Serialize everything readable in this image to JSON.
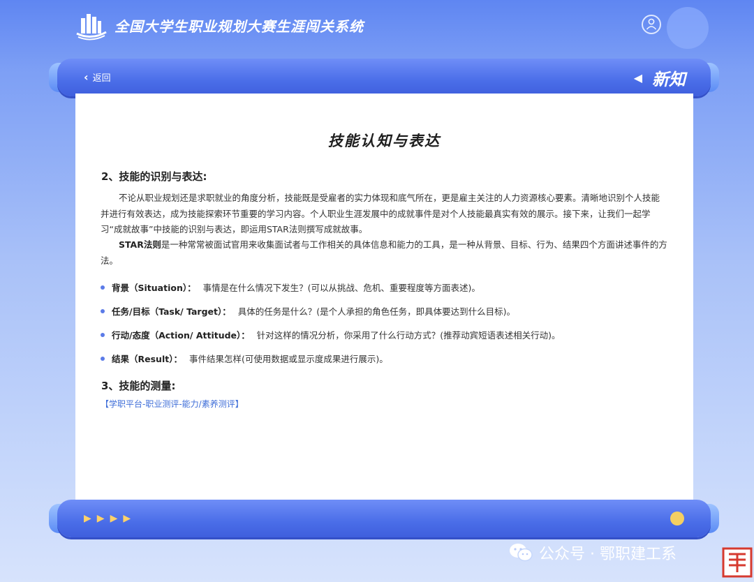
{
  "header": {
    "app_title": "全国大学生职业规划大赛生涯闯关系统",
    "avatar_icon": "user-icon"
  },
  "navbar": {
    "back_label": "返回",
    "section_label": "新知"
  },
  "document": {
    "title": "技能认知与表达",
    "section2_heading": "2、技能的识别与表达:",
    "para1": "不论从职业规划还是求职就业的角度分析，技能既是受雇者的实力体现和底气所在，更是雇主关注的人力资源核心要素。清晰地识别个人技能并进行有效表达，成为技能探索环节重要的学习内容。个人职业生涯发展中的成就事件是对个人技能最真实有效的展示。接下来，让我们一起学习“成就故事”中技能的识别与表达，即运用STAR法则撰写成就故事。",
    "para2_bold": "STAR法则",
    "para2_rest": "是一种常常被面试官用来收集面试者与工作相关的具体信息和能力的工具，是一种从背景、目标、行为、结果四个方面讲述事件的方法。",
    "bullets": [
      {
        "term": "背景（Situation）：",
        "text": "事情是在什么情况下发生？(可以从挑战、危机、重要程度等方面表述)。"
      },
      {
        "term": "任务/目标（Task/ Target）：",
        "text": "具体的任务是什么？(是个人承担的角色任务，即具体要达到什么目标)。"
      },
      {
        "term": "行动/态度（Action/ Attitude）：",
        "text": "针对这样的情况分析，你采用了什么行动方式？(推荐动宾短语表述相关行动)。"
      },
      {
        "term": "结果（Result）：",
        "text": "事件结果怎样(可使用数据或显示度成果进行展示)。"
      }
    ],
    "section3_heading": "3、技能的测量:",
    "section3_link": "【学职平台-职业测评-能力/素养测评】"
  },
  "footer": {
    "arrows": [
      "▶",
      "▶",
      "▶",
      "▶"
    ]
  },
  "watermark": {
    "text": "公众号 · 鄂职建工系"
  },
  "colors": {
    "accent": "#4a6de8",
    "link": "#3f6ed8",
    "bullet": "#5b7be8",
    "status_dot": "#f4cf62"
  }
}
